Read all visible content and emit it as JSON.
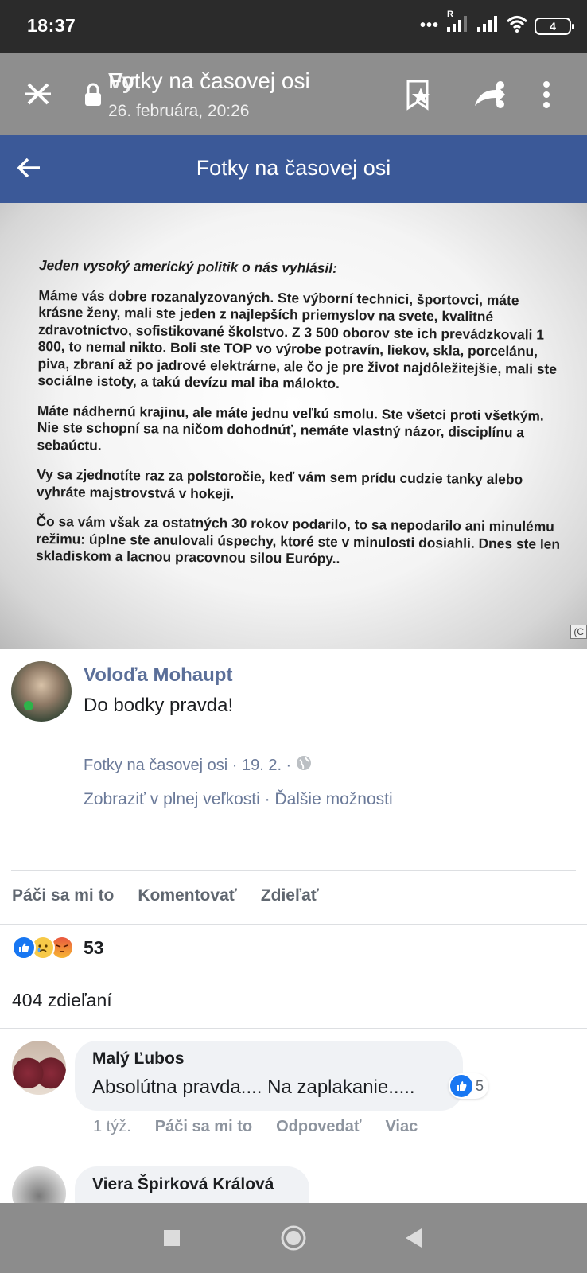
{
  "status_bar": {
    "time": "18:37",
    "roaming": "R",
    "battery": "4"
  },
  "viewer": {
    "title": "Fotky na časovej osi",
    "title_overlay": "Vy",
    "subtitle": "26. februára, 20:26"
  },
  "fb_header": {
    "title": "Fotky na časovej osi"
  },
  "photo": {
    "heading": "Jeden vysoký americký politik o nás  vyhlásil:",
    "paragraphs": [
      "Máme vás dobre rozanalyzovaných. Ste výborní technici, športovci, máte krásne ženy, mali ste jeden z najlepších priemyslov na svete, kvalitné zdravotníctvo, sofistikované školstvo. Z 3 500 oborov ste ich prevádzkovali 1 800, to nemal nikto. Boli ste TOP vo výrobe potravín, liekov, skla, porcelánu, piva, zbraní až po jadrové elektrárne, ale čo je pre život najdôležitejšie, mali ste sociálne istoty, a takú devízu mal iba málokto.",
      "Máte nádhernú krajinu, ale máte jednu veľkú smolu. Ste všetci proti všetkým.  Nie ste  schopní sa na ničom dohodnúť, nemáte vlastný názor, disciplínu a sebaúctu.",
      "Vy sa zjednotíte raz za polstoročie, keď vám sem prídu cudzie tanky alebo vyhráte majstrovstvá v hokeji.",
      "Čo sa vám však za ostatných 30 rokov podarilo, to sa nepodarilo ani minulému režimu: úplne ste anulovali úspechy, ktoré ste v minulosti dosiahli. Dnes ste len skladiskom a lacnou pracovnou silou Európy.."
    ],
    "watermark": "(C"
  },
  "post": {
    "author": "Voloďa Mohaupt",
    "text": "Do bodky pravda!",
    "meta": "Fotky na časovej osi · 19. 2. ·",
    "links": "Zobraziť v plnej veľkosti · Ďalšie možnosti"
  },
  "actions": {
    "like": "Páči sa mi to",
    "comment": "Komentovať",
    "share": "Zdieľať"
  },
  "reactions": {
    "count": "53",
    "icons": [
      "like-icon",
      "sad-icon",
      "angry-icon"
    ],
    "like_color": "#1877f2"
  },
  "shares": {
    "text": "404 zdieľaní"
  },
  "comments": [
    {
      "author": "Malý Ľubos",
      "text": "Absolútna pravda.... Na zaplakanie.....",
      "likes": "5",
      "time": "1 týž.",
      "like": "Páči sa mi to",
      "reply": "Odpovedať",
      "more": "Viac"
    },
    {
      "author": "Viera Špirková Králová"
    }
  ],
  "colors": {
    "fb_blue": "#3b5998",
    "viewer_bar": "#8e8e8e",
    "nav_bar": "#8c8c8c",
    "link": "#6b7a99"
  }
}
